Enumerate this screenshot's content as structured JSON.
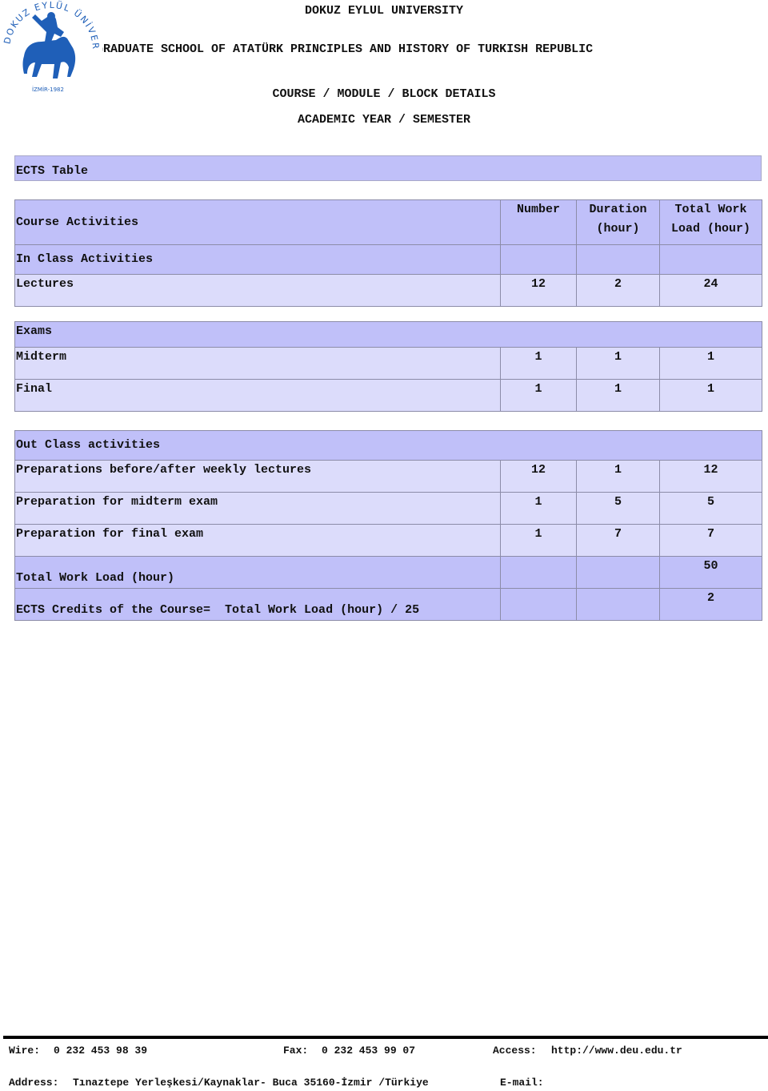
{
  "header": {
    "university": "DOKUZ EYLUL UNIVERSITY",
    "school": "GRADUATE SCHOOL OF ATATÜRK PRINCIPLES AND HISTORY OF TURKISH REPUBLIC",
    "subtitle": "COURSE / MODULE / BLOCK DETAILS",
    "term": "ACADEMIC YEAR / SEMESTER",
    "logo": {
      "icon": "university-seal-icon",
      "ring_text": "DOKUZ EYLÜL ÜNİVERSİTESİ",
      "caption": "İZMİR-1982",
      "color": "#1f5fb8"
    }
  },
  "ects": {
    "title": "ECTS Table",
    "columns": {
      "activities": "Course Activities",
      "number": "Number",
      "duration": "Duration (hour)",
      "total": "Total Work Load (hour)"
    },
    "in_class": {
      "label": "In Class Activities",
      "rows": [
        {
          "name": "Lectures",
          "number": "12",
          "duration": "2",
          "total": "24"
        }
      ]
    },
    "exams": {
      "label": "Exams",
      "rows": [
        {
          "name": "Midterm",
          "number": "1",
          "duration": "1",
          "total": "1"
        },
        {
          "name": "Final",
          "number": "1",
          "duration": "1",
          "total": "1"
        }
      ]
    },
    "out_class": {
      "label": "Out Class activities",
      "rows": [
        {
          "name": "Preparations before/after weekly lectures",
          "number": "12",
          "duration": "1",
          "total": "12"
        },
        {
          "name": "Preparation for midterm exam",
          "number": "1",
          "duration": "5",
          "total": "5"
        },
        {
          "name": "Preparation for final exam",
          "number": "1",
          "duration": "7",
          "total": "7"
        }
      ]
    },
    "total_label": "Total Work Load (hour)",
    "total_value": "50",
    "credits_label": "ECTS Credits of the Course=  Total Work Load (hour) / 25",
    "credits_value": "2",
    "colors": {
      "header": "#c0c0f9",
      "row": "#dcdcfb",
      "border": "#8c8ca8"
    }
  },
  "footer": {
    "wire_label": "Wire:",
    "wire": "0 232 453 98 39",
    "fax_label": "Fax:",
    "fax": "0 232 453 99 07",
    "access_label": "Access:",
    "access": "http://www.deu.edu.tr",
    "address_label": "Address:",
    "address": "Tınaztepe Yerleşkesi/Kaynaklar- Buca 35160-İzmir /Türkiye",
    "email_label": "E-mail:"
  }
}
